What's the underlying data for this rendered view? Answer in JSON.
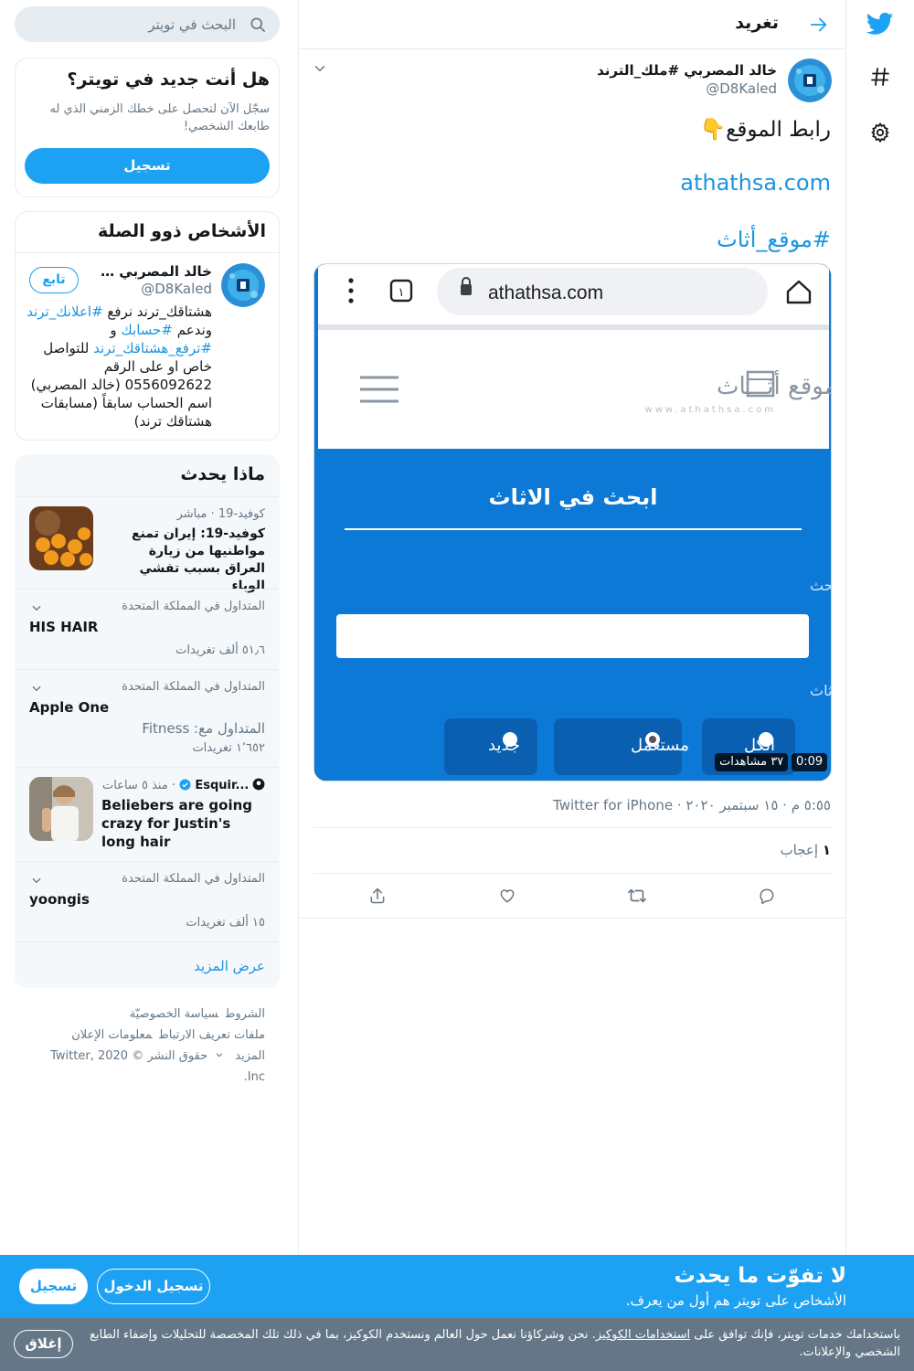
{
  "colors": {
    "brand": "#1da1f2",
    "link": "#1b95e0",
    "muted": "#657786",
    "cookie_bg": "#657786"
  },
  "nav": {
    "icons": [
      "twitter-logo-icon",
      "hashtag-icon",
      "settings-gear-icon"
    ]
  },
  "header": {
    "title": "تغريد",
    "back_icon": "arrow-right-icon"
  },
  "tweet": {
    "author_name": "خالد المصربي #ملك_الترند",
    "author_handle": "@D8Kaled",
    "text": "رابط الموقع👇",
    "link": "athathsa.com",
    "hashtag": "#موقع_أثاث",
    "timestamp": "٥:٥٥ م · ١٥ سبتمبر ٢٠٢٠ · Twitter for iPhone",
    "likes_count": "١",
    "likes_label": "إعجاب",
    "video": {
      "duration": "0:09",
      "views": "٣٧ مشاهدات",
      "browser_url": "athathsa.com",
      "tab_count": "١",
      "site_logo": "موقع أثـــاث",
      "site_logo_sub": "www.athathsa.com",
      "search_heading": "ابحث في الاثاث",
      "keyword_label": "كلمة البحث",
      "type_label": "نوع الاثاث",
      "options": [
        "الكل",
        "مستعمل",
        "جديد"
      ]
    },
    "actions": [
      "reply-icon",
      "retweet-icon",
      "like-icon",
      "share-icon"
    ]
  },
  "search": {
    "placeholder": "البحث في تويتر"
  },
  "new_to_twitter": {
    "title": "هل أنت جديد في تويتر؟",
    "subtitle": "سجّل الآن لتحصل على خطك الزمني الذي له طابعك الشخصي!",
    "signup": "تسجيل"
  },
  "relevant_people": {
    "title": "الأشخاص ذوو الصلة",
    "name": "خالد المصربي #ملك_الترند",
    "handle": "@D8Kaled",
    "follow": "تابع",
    "bio": {
      "p1": "هشتاقك_ترند نرفع ",
      "h1": "#اعلانك_ترند",
      "p2": " وندعم ",
      "h2": "#حسابك",
      "p3": " و ",
      "h3": "#ترفع_هشتاقك_ترند",
      "p4": " للتواصل خاص او على الرقم 0556092622 (خالد المصربي) اسم الحساب سابقاً (مسابقات هشتاقك ترند)"
    }
  },
  "trends": {
    "title": "ماذا يحدث",
    "items": [
      {
        "meta": "كوفيد-19 · مباشر",
        "name": "كوفيد-19: إيران تمنع مواطنيها من زيارة العراق بسبب تفشي الوباء"
      },
      {
        "meta": "المتداول في المملكة المتحدة",
        "name": "HIS HAIR",
        "count": "٥١٫٦ ألف تغريدات"
      },
      {
        "meta": "المتداول في المملكة المتحدة",
        "name": "Apple One",
        "with": "المتداول مع: Fitness",
        "count": "١٬٦٥٢ تغريدات"
      },
      {
        "source": "Esquir...",
        "time": "منذ ٥ ساعات",
        "name": "Beliebers are going crazy for Justin's long hair"
      },
      {
        "meta": "المتداول في المملكة المتحدة",
        "name": "yoongis",
        "count": "١٥ ألف تغريدات"
      }
    ],
    "show_more": "عرض المزيد"
  },
  "footer": {
    "links": [
      "الشروط",
      "سياسة الخصوصيّة",
      "ملفات تعريف الارتباط",
      "معلومات الإعلان",
      "المزيد"
    ],
    "copyright": "حقوق النشر © 2020 Twitter, Inc."
  },
  "cta": {
    "title": "لا تفوّت ما يحدث",
    "subtitle": "الأشخاص على تويتر هم أول من يعرف.",
    "login": "تسجيل الدخول",
    "signup": "تسجيل"
  },
  "cookie": {
    "pre": "باستخدامك خدمات تويتر، فإنك توافق على ",
    "link": "استخدامات الكوكيز",
    "post": ". نحن وشركاؤنا نعمل حول العالم ونستخدم الكوكيز، بما في ذلك تلك المخصصة للتحليلات وإضفاء الطابع الشخصي والإعلانات.",
    "close": "إغلاق"
  }
}
